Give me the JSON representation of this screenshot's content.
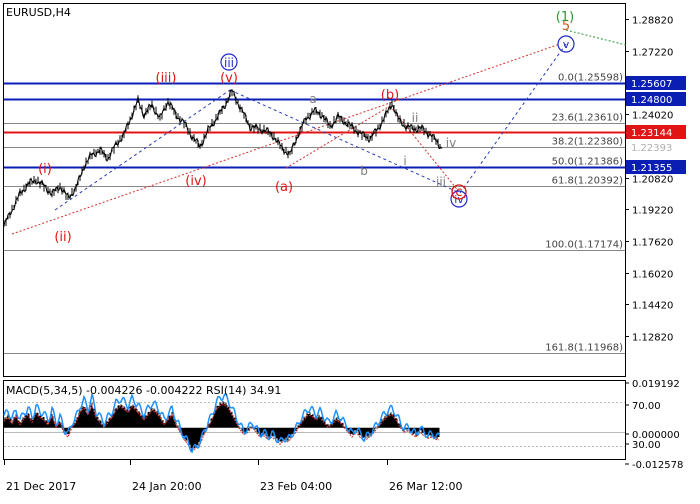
{
  "chart_data": [
    {
      "type": "line",
      "title": "EURUSD,H4",
      "xlabel": "",
      "ylabel": "",
      "ylim": [
        1.108,
        1.296
      ],
      "x_ticks": [
        "21 Dec 2017",
        "24 Jan 20:00",
        "23 Feb 04:00",
        "26 Mar 12:00"
      ],
      "y_ticks": [
        "1.28820",
        "1.27220",
        "1.25600",
        "1.24020",
        "1.20820",
        "1.19220",
        "1.17620",
        "1.16020",
        "1.14420",
        "1.12820"
      ],
      "series": [
        {
          "values": [
            [
              0,
              1.184
            ],
            [
              8,
              1.192
            ],
            [
              16,
              1.2
            ],
            [
              24,
              1.205
            ],
            [
              32,
              1.207
            ],
            [
              40,
              1.204
            ],
            [
              48,
              1.2
            ],
            [
              56,
              1.204
            ],
            [
              64,
              1.198
            ],
            [
              72,
              1.203
            ],
            [
              80,
              1.214
            ],
            [
              88,
              1.22
            ],
            [
              96,
              1.222
            ],
            [
              104,
              1.218
            ],
            [
              112,
              1.225
            ],
            [
              120,
              1.23
            ],
            [
              128,
              1.24
            ],
            [
              134,
              1.247
            ],
            [
              140,
              1.24
            ],
            [
              148,
              1.245
            ],
            [
              156,
              1.238
            ],
            [
              164,
              1.247
            ],
            [
              172,
              1.24
            ],
            [
              180,
              1.236
            ],
            [
              188,
              1.229
            ],
            [
              196,
              1.224
            ],
            [
              204,
              1.232
            ],
            [
              212,
              1.238
            ],
            [
              220,
              1.244
            ],
            [
              228,
              1.252
            ],
            [
              232,
              1.248
            ],
            [
              238,
              1.242
            ],
            [
              246,
              1.234
            ],
            [
              254,
              1.233
            ],
            [
              262,
              1.232
            ],
            [
              270,
              1.229
            ],
            [
              278,
              1.223
            ],
            [
              286,
              1.22
            ],
            [
              294,
              1.23
            ],
            [
              302,
              1.238
            ],
            [
              310,
              1.242
            ],
            [
              318,
              1.24
            ],
            [
              326,
              1.234
            ],
            [
              334,
              1.239
            ],
            [
              342,
              1.236
            ],
            [
              350,
              1.233
            ],
            [
              358,
              1.23
            ],
            [
              366,
              1.228
            ],
            [
              374,
              1.233
            ],
            [
              382,
              1.24
            ],
            [
              388,
              1.246
            ],
            [
              394,
              1.238
            ],
            [
              402,
              1.234
            ],
            [
              410,
              1.233
            ],
            [
              418,
              1.233
            ],
            [
              426,
              1.23
            ],
            [
              432,
              1.227
            ],
            [
              438,
              1.223
            ]
          ]
        }
      ],
      "price_markers": [
        {
          "value": 1.25607,
          "label": "1.25607",
          "color": "#0a1eb4"
        },
        {
          "value": 1.248,
          "label": "1.24800",
          "color": "#0a1eb4"
        },
        {
          "value": 1.23144,
          "label": "1.23144",
          "color": "#e01414"
        },
        {
          "value": 1.22393,
          "label": "1.22393",
          "color": "#c8c8c8"
        },
        {
          "value": 1.21355,
          "label": "1.21355",
          "color": "#0a1eb4"
        }
      ],
      "fib_levels": [
        {
          "value": 1.25598,
          "label": "0.0(1.25598)"
        },
        {
          "value": 1.2361,
          "label": "23.6(1.23610)"
        },
        {
          "value": 1.2238,
          "label": "38.2(1.22380)"
        },
        {
          "value": 1.21386,
          "label": "50.0(1.21386)"
        },
        {
          "value": 1.20392,
          "label": "61.8(1.20392)"
        },
        {
          "value": 1.17174,
          "label": "100.0(1.17174)"
        },
        {
          "value": 1.11968,
          "label": "161.8(1.11968)"
        }
      ],
      "wave_labels": [
        {
          "text": "(i)",
          "color": "#e01414"
        },
        {
          "text": "(ii)",
          "color": "#e01414"
        },
        {
          "text": "(iii)",
          "color": "#e01414"
        },
        {
          "text": "(iv)",
          "color": "#e01414"
        },
        {
          "text": "(v)",
          "color": "#e01414"
        },
        {
          "text": "iii",
          "color": "#1e28c8"
        },
        {
          "text": "(a)",
          "color": "#e01414"
        },
        {
          "text": "(b)",
          "color": "#e01414"
        },
        {
          "text": "(c)",
          "color": "#e01414"
        },
        {
          "text": "a",
          "color": "#808080"
        },
        {
          "text": "b",
          "color": "#808080"
        },
        {
          "text": "i",
          "color": "#808080"
        },
        {
          "text": "ii",
          "color": "#808080"
        },
        {
          "text": "iii",
          "color": "#808080"
        },
        {
          "text": "iv",
          "color": "#808080"
        },
        {
          "text": "iv",
          "color": "#1e28c8"
        },
        {
          "text": "v",
          "color": "#1e28c8"
        },
        {
          "text": "5",
          "color": "#c85a1e"
        },
        {
          "text": "(1)",
          "color": "#2a9632"
        }
      ],
      "grid": false
    },
    {
      "type": "line",
      "title": "MACD(5,34,5) -0.004226 -0.004222 RSI(14) 34.91",
      "ylim": [
        -0.0128,
        0.0192
      ],
      "y_ticks": [
        "0.019192",
        "70.00",
        "0.000000",
        "30.00",
        "-0.012578"
      ],
      "series": [
        {
          "values": [
            [
              0,
              0.0035
            ],
            [
              4,
              0.005
            ],
            [
              8,
              0.0025
            ],
            [
              12,
              0.0055
            ],
            [
              16,
              0.002
            ],
            [
              20,
              0.0045
            ],
            [
              24,
              0.006
            ],
            [
              28,
              0.003
            ],
            [
              32,
              0.0065
            ],
            [
              36,
              0.005
            ],
            [
              40,
              0.004
            ],
            [
              44,
              0.002
            ],
            [
              48,
              0.0055
            ],
            [
              52,
              0.001
            ],
            [
              56,
              0.003
            ],
            [
              60,
              -0.0015
            ],
            [
              64,
              -0.003
            ],
            [
              68,
              0.001
            ],
            [
              72,
              0.003
            ],
            [
              76,
              0.007
            ],
            [
              80,
              0.009
            ],
            [
              84,
              0.006
            ],
            [
              88,
              0.01
            ],
            [
              92,
              0.005
            ],
            [
              96,
              0.003
            ],
            [
              100,
              0.001
            ],
            [
              104,
              0.003
            ],
            [
              108,
              0.005
            ],
            [
              112,
              0.008
            ],
            [
              116,
              0.0095
            ],
            [
              120,
              0.0085
            ],
            [
              124,
              0.007
            ],
            [
              128,
              0.0095
            ],
            [
              132,
              0.008
            ],
            [
              136,
              0.006
            ],
            [
              140,
              0.004
            ],
            [
              144,
              0.006
            ],
            [
              148,
              0.008
            ],
            [
              152,
              0.007
            ],
            [
              156,
              0.005
            ],
            [
              160,
              0.002
            ],
            [
              164,
              0.004
            ],
            [
              168,
              0.006
            ],
            [
              172,
              0.002
            ],
            [
              176,
              -0.001
            ],
            [
              180,
              -0.004
            ],
            [
              184,
              -0.006
            ],
            [
              188,
              -0.009
            ],
            [
              192,
              -0.0075
            ],
            [
              196,
              -0.006
            ],
            [
              200,
              -0.002
            ],
            [
              204,
              0.001
            ],
            [
              208,
              0.004
            ],
            [
              212,
              0.008
            ],
            [
              216,
              0.01
            ],
            [
              220,
              0.0105
            ],
            [
              224,
              0.009
            ],
            [
              228,
              0.006
            ],
            [
              232,
              0.003
            ],
            [
              236,
              0.0
            ],
            [
              240,
              -0.002
            ],
            [
              244,
              -0.001
            ],
            [
              248,
              0.001
            ],
            [
              252,
              -0.001
            ],
            [
              256,
              -0.003
            ],
            [
              260,
              -0.0025
            ],
            [
              264,
              -0.004
            ],
            [
              268,
              -0.003
            ],
            [
              272,
              -0.0045
            ],
            [
              276,
              -0.006
            ],
            [
              280,
              -0.0045
            ],
            [
              284,
              -0.005
            ],
            [
              288,
              -0.003
            ],
            [
              292,
              -0.001
            ],
            [
              296,
              0.002
            ],
            [
              300,
              0.004
            ],
            [
              304,
              0.006
            ],
            [
              308,
              0.0055
            ],
            [
              312,
              0.004
            ],
            [
              316,
              0.005
            ],
            [
              320,
              0.003
            ],
            [
              324,
              0.001
            ],
            [
              328,
              0.002
            ],
            [
              332,
              0.004
            ],
            [
              336,
              0.003
            ],
            [
              340,
              0.001
            ],
            [
              344,
              -0.001
            ],
            [
              348,
              -0.003
            ],
            [
              352,
              -0.001
            ],
            [
              356,
              -0.003
            ],
            [
              360,
              -0.0045
            ],
            [
              364,
              -0.0035
            ],
            [
              368,
              -0.002
            ],
            [
              372,
              0.0
            ],
            [
              376,
              0.002
            ],
            [
              380,
              0.004
            ],
            [
              384,
              0.0055
            ],
            [
              388,
              0.006
            ],
            [
              392,
              0.004
            ],
            [
              396,
              0.001
            ],
            [
              400,
              -0.001
            ],
            [
              404,
              -0.0005
            ],
            [
              408,
              -0.002
            ],
            [
              412,
              -0.003
            ],
            [
              416,
              -0.001
            ],
            [
              420,
              -0.0025
            ],
            [
              424,
              -0.0035
            ],
            [
              428,
              -0.003
            ],
            [
              432,
              -0.004
            ],
            [
              436,
              -0.0042
            ]
          ]
        }
      ],
      "grid": false
    }
  ]
}
